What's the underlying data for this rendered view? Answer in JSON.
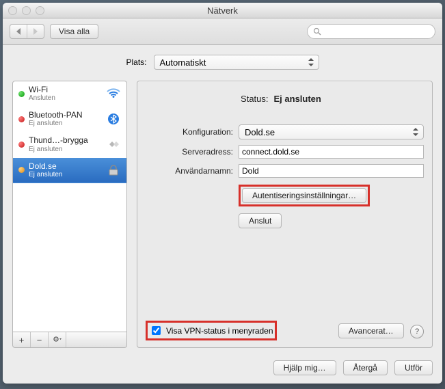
{
  "title": "Nätverk",
  "toolbar": {
    "show_all": "Visa alla",
    "search_placeholder": ""
  },
  "location": {
    "label": "Plats:",
    "value": "Automatiskt"
  },
  "sidebar": {
    "items": [
      {
        "name": "Wi-Fi",
        "status": "Ansluten",
        "dot": "green",
        "icon": "wifi"
      },
      {
        "name": "Bluetooth-PAN",
        "status": "Ej ansluten",
        "dot": "red",
        "icon": "bluetooth"
      },
      {
        "name": "Thund…-brygga",
        "status": "Ej ansluten",
        "dot": "red",
        "icon": "thunderbolt"
      },
      {
        "name": "Dold.se",
        "status": "Ej ansluten",
        "dot": "orange",
        "icon": "lock"
      }
    ]
  },
  "status": {
    "label": "Status:",
    "value": "Ej ansluten"
  },
  "form": {
    "config_label": "Konfiguration:",
    "config_value": "Dold.se",
    "server_label": "Serveradress:",
    "server_value": "connect.dold.se",
    "user_label": "Användarnamn:",
    "user_value": "Dold",
    "auth_button": "Autentiseringsinställningar…",
    "connect_button": "Anslut"
  },
  "panel_footer": {
    "checkbox_label": "Visa VPN-status i menyraden",
    "advanced": "Avancerat…"
  },
  "bottom": {
    "help": "Hjälp mig…",
    "revert": "Återgå",
    "apply": "Utför"
  }
}
